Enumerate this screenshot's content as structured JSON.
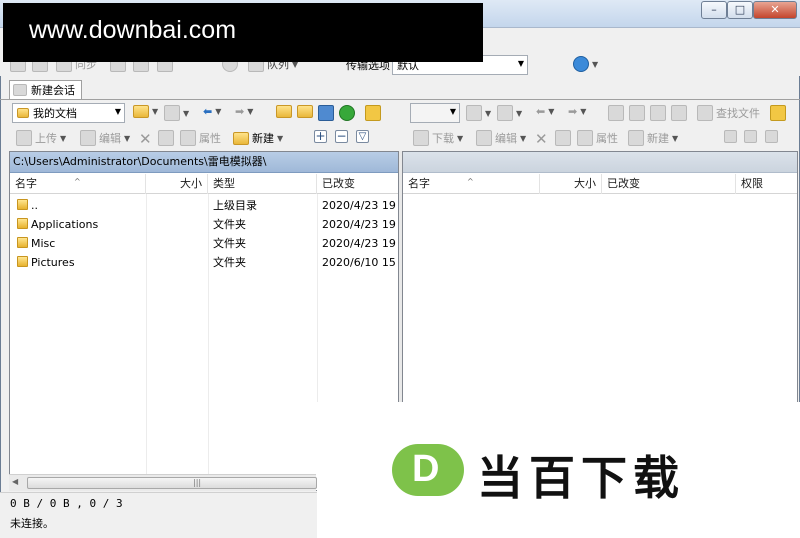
{
  "watermark": {
    "url": "www.downbai.com",
    "logo_letter": "D",
    "logo_text": "当百下载"
  },
  "toolbar1": {
    "sync_label": "同步",
    "queue_label": "队列",
    "transfer_label": "传输选项",
    "transfer_value": "默认"
  },
  "session_tab": {
    "label": "新建会话"
  },
  "local": {
    "location": "我的文档",
    "path": "C:\\Users\\Administrator\\Documents\\雷电模拟器\\",
    "upload": "上传",
    "edit": "编辑",
    "props": "属性",
    "new": "新建",
    "columns": {
      "name": "名字",
      "size": "大小",
      "type": "类型",
      "modified": "已改变"
    },
    "files": [
      {
        "name": "..",
        "size": "",
        "type": "上级目录",
        "modified": "2020/4/23  19"
      },
      {
        "name": "Applications",
        "size": "",
        "type": "文件夹",
        "modified": "2020/4/23  19"
      },
      {
        "name": "Misc",
        "size": "",
        "type": "文件夹",
        "modified": "2020/4/23  19"
      },
      {
        "name": "Pictures",
        "size": "",
        "type": "文件夹",
        "modified": "2020/6/10  15"
      }
    ]
  },
  "remote": {
    "find_files": "查找文件",
    "download": "下载",
    "edit": "编辑",
    "props": "属性",
    "new": "新建",
    "columns": {
      "name": "名字",
      "size": "大小",
      "modified": "已改变",
      "rights": "权限"
    }
  },
  "status": {
    "line1": "0 B / 0 B , 0 / 3",
    "line2": "未连接。"
  },
  "icons": [
    "folder-icon",
    "filter-icon",
    "back-icon",
    "forward-icon",
    "parent-folder-icon",
    "root-icon",
    "home-icon",
    "refresh-icon",
    "tree-icon",
    "plus-icon",
    "minus-icon",
    "select-icon",
    "delete-icon",
    "globe-icon",
    "gear-icon"
  ]
}
